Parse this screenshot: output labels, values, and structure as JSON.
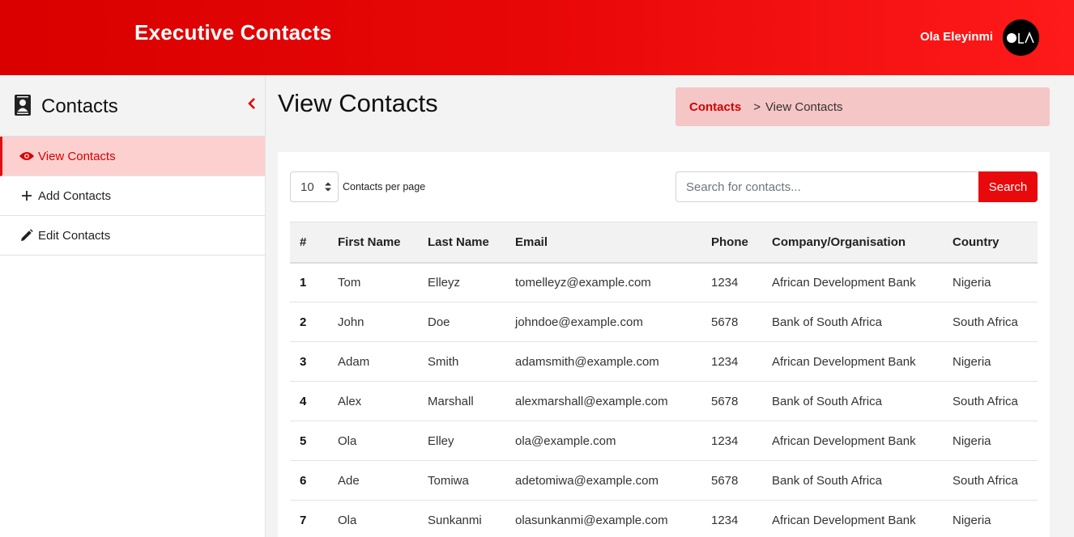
{
  "header": {
    "app_title": "Executive Contacts",
    "user_name": "Ola Eleyinmi",
    "avatar_text": "OLA"
  },
  "sidebar": {
    "title": "Contacts",
    "items": [
      {
        "label": "View Contacts",
        "icon": "eye-icon",
        "active": true
      },
      {
        "label": "Add Contacts",
        "icon": "plus-icon",
        "active": false
      },
      {
        "label": "Edit Contacts",
        "icon": "pencil-icon",
        "active": false
      }
    ]
  },
  "main": {
    "page_title": "View Contacts",
    "breadcrumb": {
      "parent": "Contacts",
      "separator": ">",
      "current": "View Contacts"
    },
    "per_page": {
      "value": "10",
      "label": "Contacts per page"
    },
    "search": {
      "placeholder": "Search for contacts...",
      "button_label": "Search"
    },
    "table": {
      "headers": [
        "#",
        "First Name",
        "Last Name",
        "Email",
        "Phone",
        "Company/Organisation",
        "Country"
      ],
      "rows": [
        [
          "1",
          "Tom",
          "Elleyz",
          "tomelleyz@example.com",
          "1234",
          "African Development Bank",
          "Nigeria"
        ],
        [
          "2",
          "John",
          "Doe",
          "johndoe@example.com",
          "5678",
          "Bank of South Africa",
          "South Africa"
        ],
        [
          "3",
          "Adam",
          "Smith",
          "adamsmith@example.com",
          "1234",
          "African Development Bank",
          "Nigeria"
        ],
        [
          "4",
          "Alex",
          "Marshall",
          "alexmarshall@example.com",
          "5678",
          "Bank of South Africa",
          "South Africa"
        ],
        [
          "5",
          "Ola",
          "Elley",
          "ola@example.com",
          "1234",
          "African Development Bank",
          "Nigeria"
        ],
        [
          "6",
          "Ade",
          "Tomiwa",
          "adetomiwa@example.com",
          "5678",
          "Bank of South Africa",
          "South Africa"
        ],
        [
          "7",
          "Ola",
          "Sunkanmi",
          "olasunkanmi@example.com",
          "1234",
          "African Development Bank",
          "Nigeria"
        ]
      ]
    }
  },
  "colors": {
    "brand_red": "#e8090c",
    "active_bg": "#fdd0d0",
    "breadcrumb_bg": "#f5c6c6"
  }
}
